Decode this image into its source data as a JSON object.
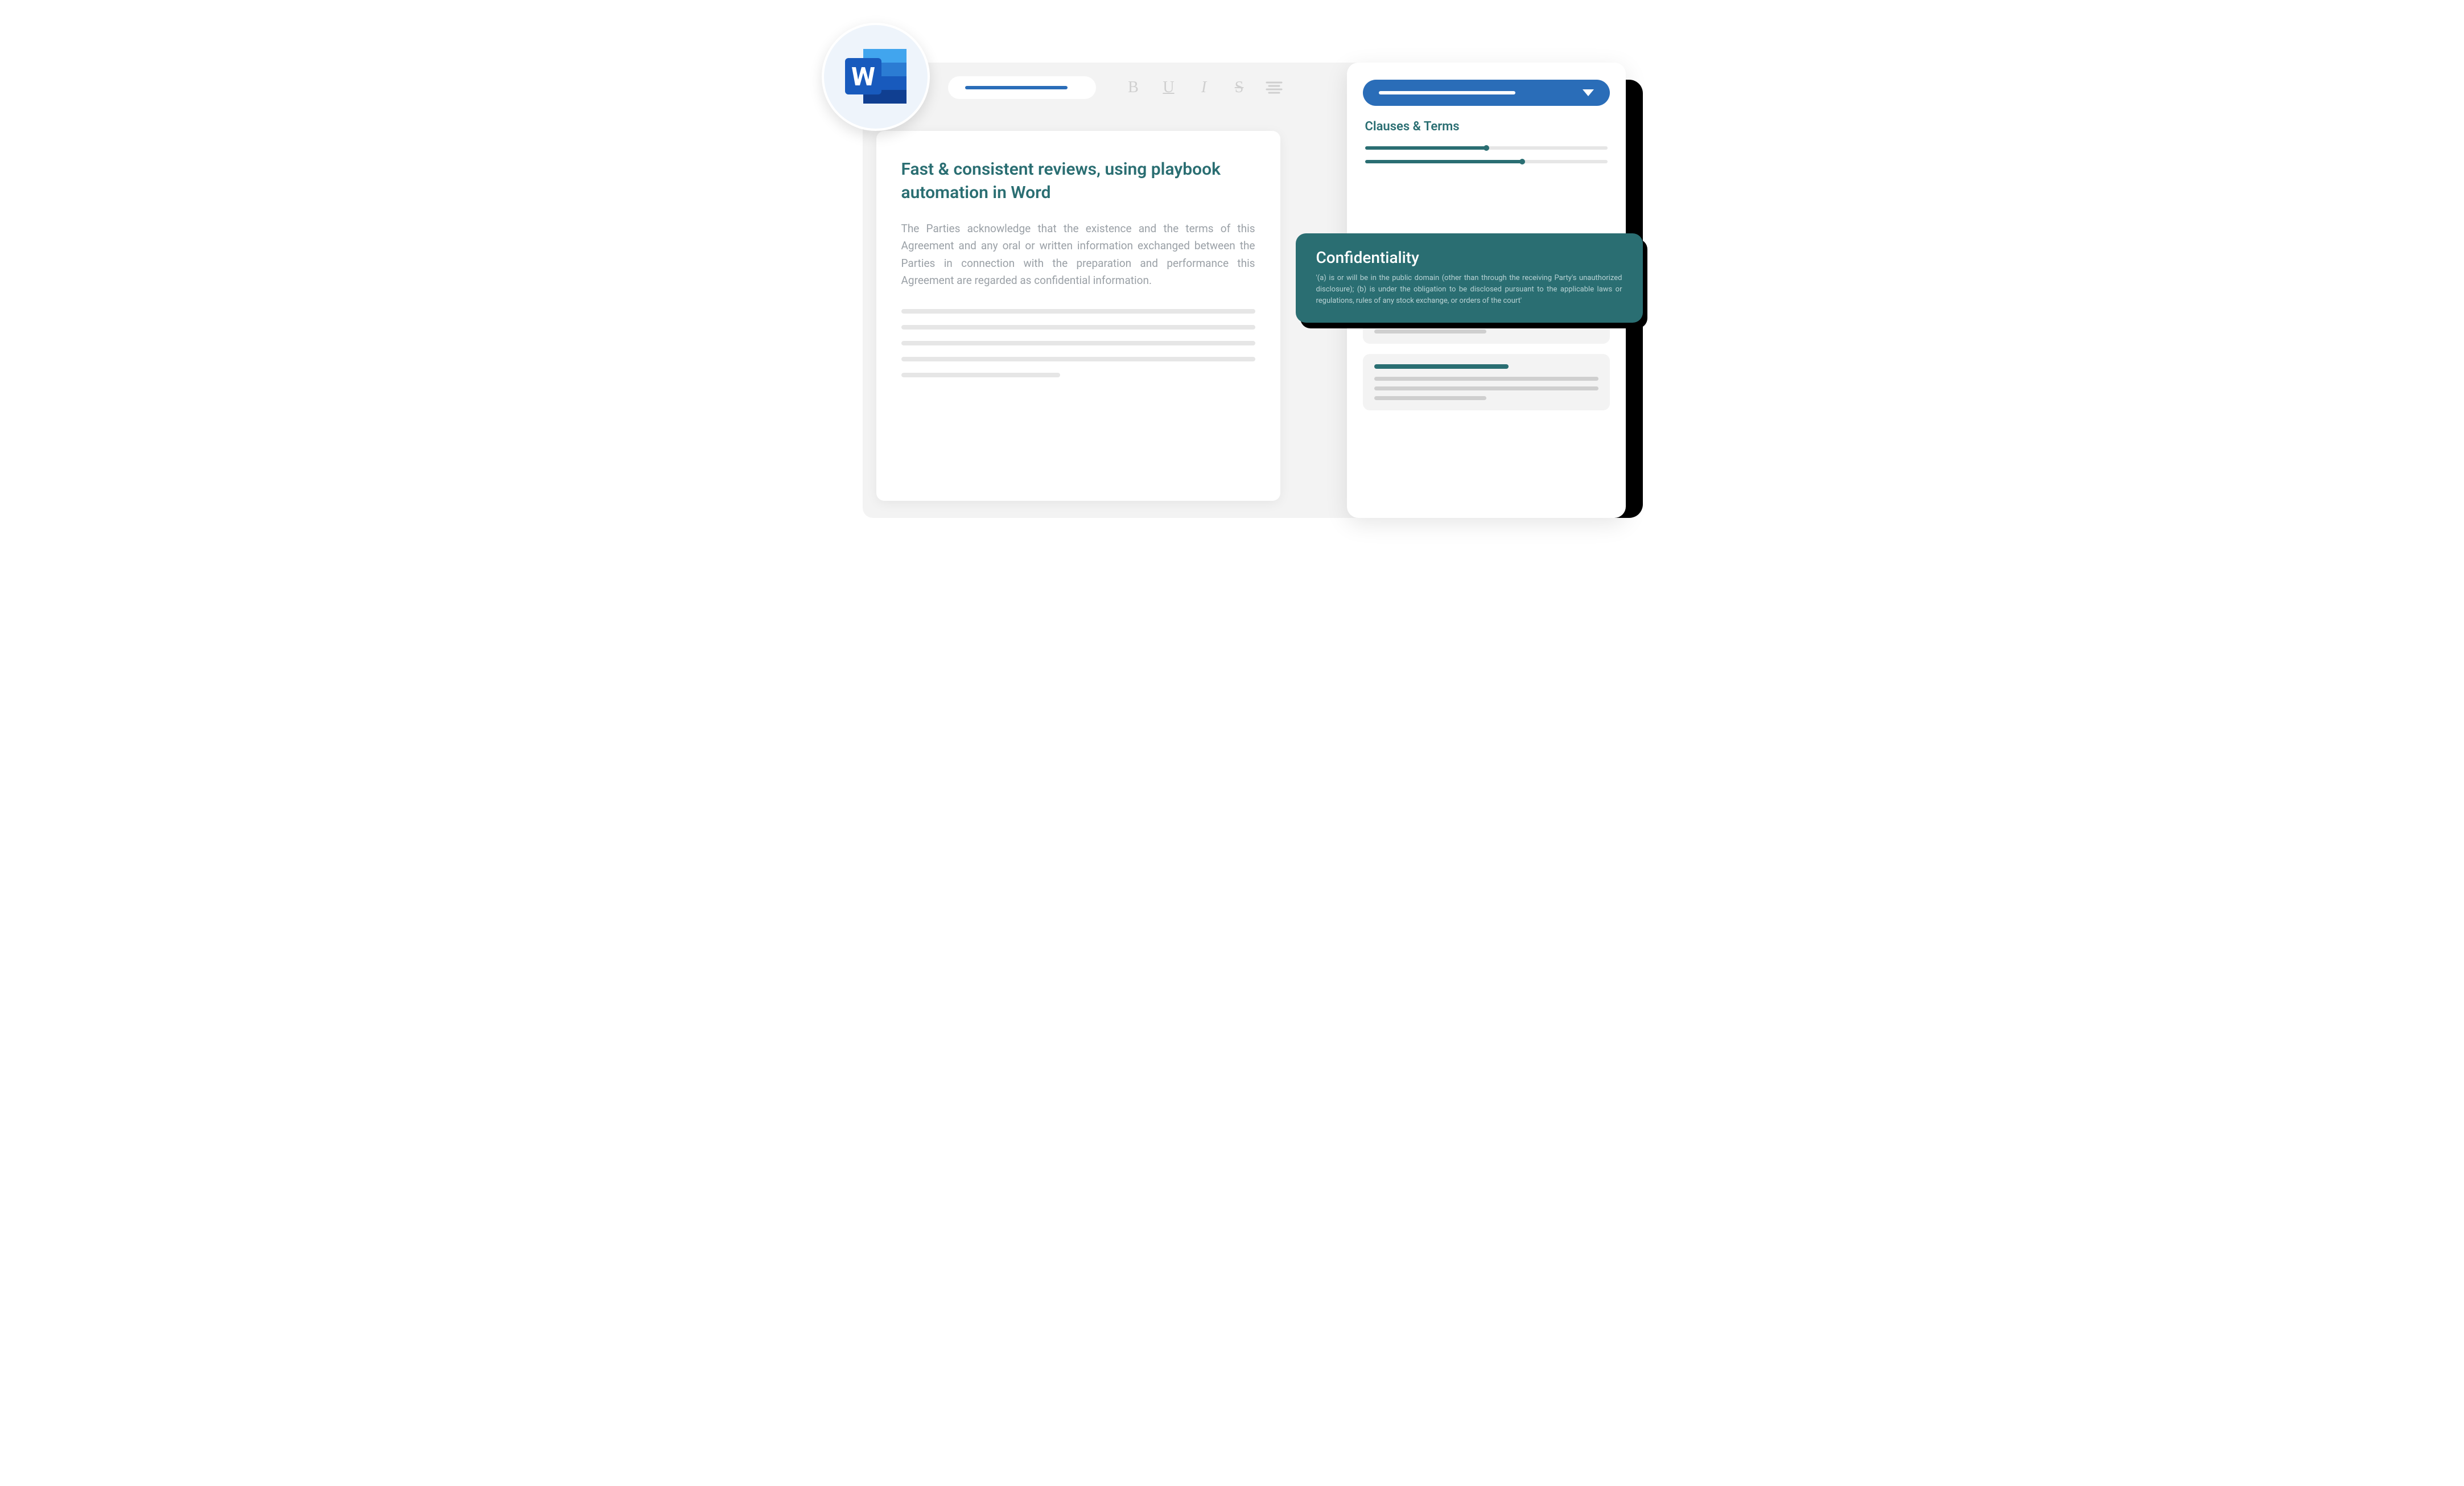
{
  "toolbar": {
    "bold": "B",
    "underline": "U",
    "italic": "I",
    "strike": "S"
  },
  "document": {
    "title": "Fast & consistent reviews, using playbook automation in Word",
    "body": "The Parties acknowledge that the existence and the terms of this Agreement and any oral or written information exchanged between the Parties in connection with the preparation and performance this Agreement are regarded as confidential information."
  },
  "sidebar": {
    "section_title": "Clauses & Terms",
    "slider1_percent": 50,
    "slider2_percent": 65
  },
  "callout": {
    "title": "Confidentiality",
    "body": "'(a) is or will be in the public domain (other than through the receiving Party's unauthorized disclosure); (b) is under the obligation to be disclosed pursuant to the applicable laws or regulations, rules of any stock exchange, or orders of the court'"
  }
}
